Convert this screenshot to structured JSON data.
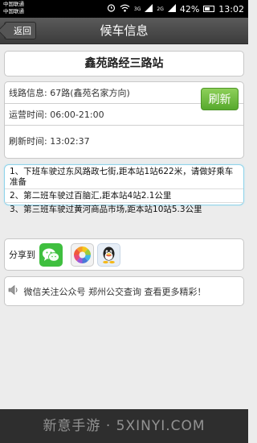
{
  "status_bar": {
    "carrier_line1": "中国联通",
    "carrier_line2": "中国联通",
    "network_badge": "3G",
    "network_badge2": "2G",
    "battery": "42%",
    "time": "13:02"
  },
  "header": {
    "back_label": "返回",
    "title": "候车信息"
  },
  "station": {
    "name": "鑫苑路经三路站"
  },
  "info": {
    "route": "线路信息: 67路(鑫苑名家方向)",
    "hours": "运营时间: 06:00-21:00",
    "refresh_time": "刷新时间: 13:02:37",
    "refresh_label": "刷新"
  },
  "buses": [
    "1、下班车驶过东风路政七街,距本站1站622米，请做好乘车准备",
    "2、第二班车驶过百脑汇,距本站4站2.1公里",
    "3、第三班车驶过黄河商品市场,距本站10站5.3公里"
  ],
  "share": {
    "label": "分享到"
  },
  "notice": {
    "text": "微信关注公众号  郑州公交查询  查看更多精彩！"
  },
  "watermark": "新意手游 · 5XINYI.COM",
  "colors": {
    "title_bar": "#4a4a4a",
    "refresh_green": "#6cbd3c",
    "bus_border": "#8fd3ea"
  }
}
